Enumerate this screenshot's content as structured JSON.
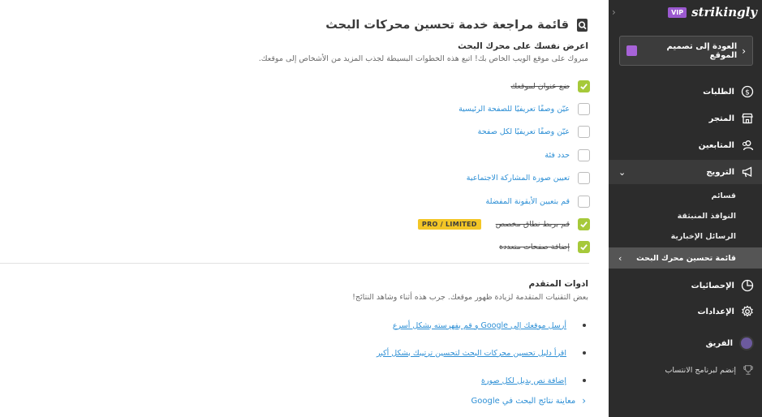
{
  "sidebar": {
    "logo": "strikingly",
    "vip": "VIP",
    "back_button": "العودة إلى تصميم الموقع",
    "items": {
      "orders": "الطلبات",
      "store": "المتجر",
      "followers": "المتابعين",
      "marketing": "الترويج",
      "analytics": "الإحصائيات",
      "settings": "الإعدادات",
      "team": "الفريق",
      "affiliate": "إنضم لبرنامج الانتساب"
    },
    "marketing_sub": {
      "lists": "قسائم",
      "popups": "النوافذ المنبثقة",
      "newsletters": "الرسائل الإخبارية",
      "seo": "قائمة تحسين محرك البحث"
    }
  },
  "main": {
    "title": "قائمة مراجعة خدمة تحسين محركات البحث",
    "section1": {
      "title": "اعرض نفسك على محرك البحث",
      "desc": "مبروك على موقع الويب الخاص بك! اتبع هذه الخطوات البسيطة لجذب المزيد من الأشخاص إلى موقعك."
    },
    "checklist": [
      {
        "label": "ضع عنوان لموقعك",
        "checked": true
      },
      {
        "label": "عيّن وصفًا تعريفيًا للصفحة الرئيسية",
        "checked": false
      },
      {
        "label": "عيّن وصفًا تعريفيًا لكل صفحة",
        "checked": false
      },
      {
        "label": "حدد فئة",
        "checked": false
      },
      {
        "label": "تعيين صورة المشاركة الاجتماعية",
        "checked": false
      },
      {
        "label": "قم بتعيين الأيقونة المفضلة",
        "checked": false
      },
      {
        "label": "قم بربط نطاق مخصص",
        "checked": true,
        "badge": "PRO / LIMITED"
      },
      {
        "label": "إضافة صفحات متعددة",
        "checked": true
      }
    ],
    "section2": {
      "title": "ادوات المتقدم",
      "desc": "بعض التقنيات المتقدمة لزيادة ظهور موقعك. جرب هذه أثناء وشاهد النتائج!"
    },
    "advanced": [
      "أرسل موقعك إلى Google و قم بفهرسته بشكل أسرع",
      "اقرأ دليل تحسين محركات البحث لتحسين ترتيبك بشكل أكبر",
      "إضافة نص بديل لكل صورة"
    ],
    "preview_link": "معاينة نتائج البحث في Google"
  },
  "colors": {
    "accent": "#2d8fd5",
    "check": "#a6c93a",
    "badge": "#f3c626",
    "sidebar_bg": "#2c2c2c",
    "vip": "#9b59d0"
  }
}
